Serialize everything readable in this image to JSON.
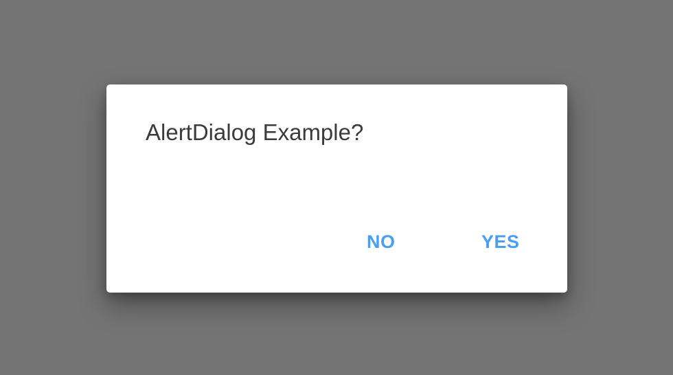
{
  "dialog": {
    "message": "AlertDialog Example?",
    "buttons": {
      "negative_label": "NO",
      "positive_label": "YES"
    }
  },
  "colors": {
    "scrim": "#747474",
    "surface": "#ffffff",
    "message_text": "#3b3b3b",
    "accent": "#4a9ef3"
  }
}
